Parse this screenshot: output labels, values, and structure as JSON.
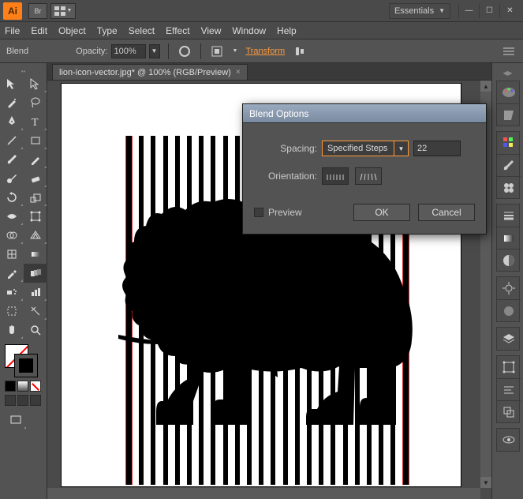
{
  "app": {
    "badge": "Ai",
    "br_label": "Br",
    "workspace": "Essentials"
  },
  "menu": {
    "file": "File",
    "edit": "Edit",
    "object": "Object",
    "type": "Type",
    "select": "Select",
    "effect": "Effect",
    "view": "View",
    "window": "Window",
    "help": "Help"
  },
  "control": {
    "tool": "Blend",
    "opacity_label": "Opacity:",
    "opacity_value": "100%",
    "transform": "Transform"
  },
  "document": {
    "tab": "lion-icon-vector.jpg* @ 100% (RGB/Preview)"
  },
  "dialog": {
    "title": "Blend Options",
    "spacing_label": "Spacing:",
    "spacing_value": "Specified Steps",
    "steps_value": "22",
    "orientation_label": "Orientation:",
    "preview_label": "Preview",
    "ok": "OK",
    "cancel": "Cancel"
  }
}
